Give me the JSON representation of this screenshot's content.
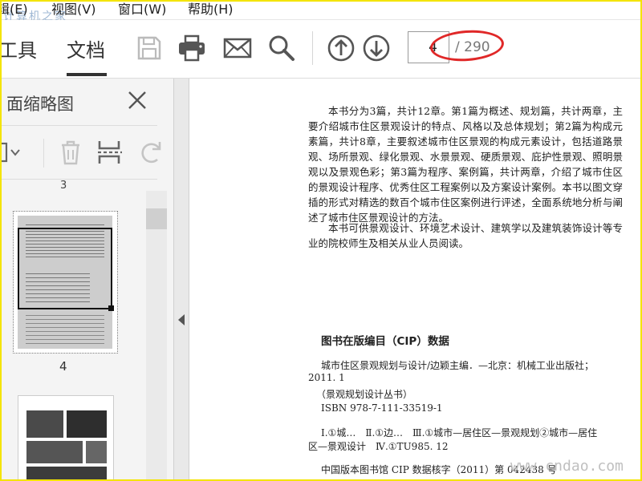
{
  "menu": {
    "items": [
      "辑(E)",
      "视图(V)",
      "窗口(W)",
      "帮助(H)"
    ],
    "watermark_tl": "计算机之家"
  },
  "toolbar": {
    "tabs": [
      {
        "label": "工具",
        "active": false
      },
      {
        "label": "文档",
        "active": true
      }
    ],
    "icons": [
      "save-icon",
      "print-icon",
      "mail-icon",
      "search-icon",
      "page-up-icon",
      "page-down-icon"
    ],
    "current_page": "4",
    "total_pages": "/ 290"
  },
  "side_panel": {
    "title": "面缩略图",
    "tools": [
      "page-options-icon",
      "delete-icon",
      "extract-icon",
      "rotate-icon"
    ],
    "prev_label": "3",
    "thumb_label": "4"
  },
  "document": {
    "paragraphs": [
      "本书分为3篇，共计12章。第1篇为概述、规划篇，共计两章，主要介绍城市住区景观设计的特点、风格以及总体规划；第2篇为构成元素篇，共计8章，主要叙述城市住区景观的构成元素设计，包括道路景观、场所景观、绿化景观、水景景观、硬质景观、庇护性景观、照明景观以及景观色彩；第3篇为程序、案例篇，共计两章，介绍了城市住区的景观设计程序、优秀住区工程案例以及方案设计案例。本书以图文穿插的形式对精选的数百个城市住区案例进行评述，全面系统地分析与阐述了城市住区景观设计的方法。",
      "本书可供景观设计、环境艺术设计、建筑学以及建筑装饰设计等专业的院校师生及相关从业人员阅读。"
    ],
    "cip_title": "图书在版编目（CIP）数据",
    "cip_lines": [
      "城市住区景观规划与设计/边颖主编．—北京：机械工业出版社；",
      "2011. 1",
      "（景观规划设计丛书）",
      "ISBN 978-7-111-33519-1",
      "Ⅰ.①城…　Ⅱ.①边…　Ⅲ.①城市—居住区—景观规划②城市—居住",
      "区—景观设计　Ⅳ.①TU985. 12",
      "中国版本图书馆 CIP 数据核字（2011）第 042438 号"
    ]
  },
  "watermark": "www.cndao.com"
}
